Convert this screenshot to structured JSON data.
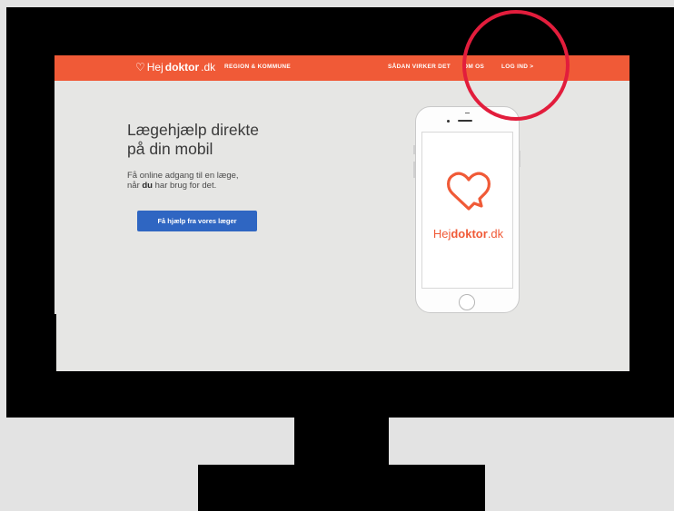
{
  "nav": {
    "logo_prefix": "Hej",
    "logo_bold": "doktor",
    "logo_suffix": ".dk",
    "region": "REGION & KOMMUNE",
    "how": "SÅDAN VIRKER DET",
    "about": "OM OS",
    "login": "LOG IND >"
  },
  "hero": {
    "title_line1": "Lægehjælp direkte",
    "title_line2": "på din mobil",
    "sub_line1": "Få online adgang til en læge,",
    "sub_line2_pre": "når ",
    "sub_line2_bold": "du",
    "sub_line2_post": " har brug for det.",
    "cta": "Få hjælp fra vores læger"
  },
  "phone": {
    "app_prefix": "Hej",
    "app_bold": "doktor",
    "app_suffix": ".dk"
  },
  "colors": {
    "brand": "#f05a37",
    "cta": "#2f66c2",
    "annotation": "#e21d3c"
  },
  "icons": {
    "logo": "heart-speech-icon",
    "app": "heart-speech-icon"
  }
}
